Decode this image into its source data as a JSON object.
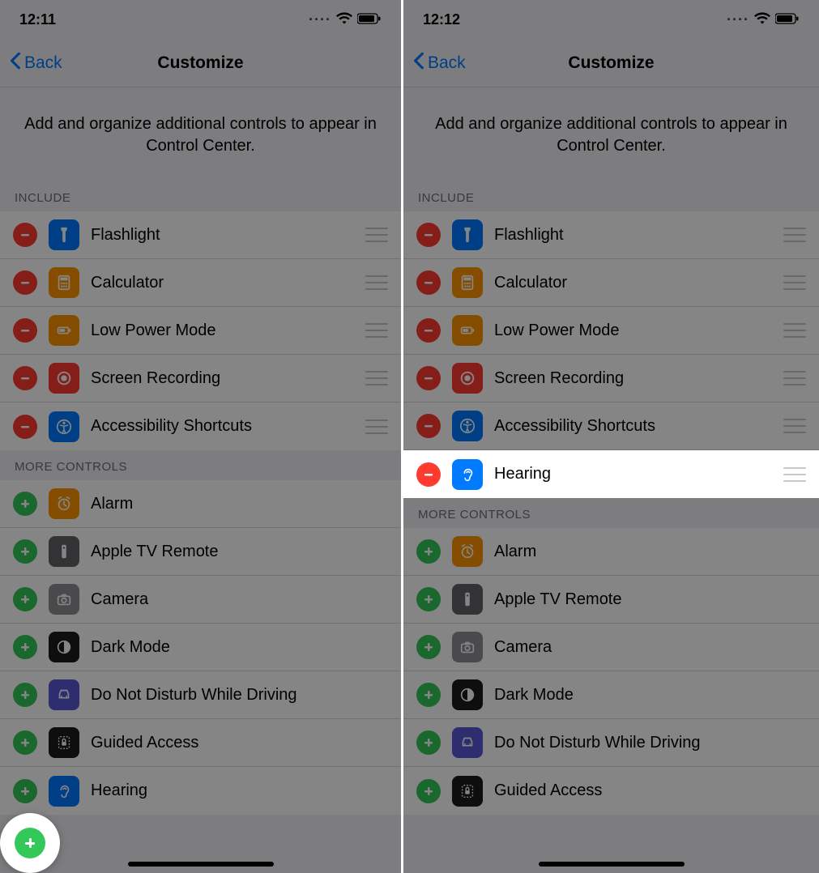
{
  "left": {
    "status": {
      "time": "12:11"
    },
    "nav": {
      "back": "Back",
      "title": "Customize"
    },
    "intro": "Add and organize additional controls to appear in Control Center.",
    "sections": {
      "include_header": "INCLUDE",
      "more_header": "MORE CONTROLS"
    },
    "include": [
      {
        "label": "Flashlight"
      },
      {
        "label": "Calculator"
      },
      {
        "label": "Low Power Mode"
      },
      {
        "label": "Screen Recording"
      },
      {
        "label": "Accessibility Shortcuts"
      }
    ],
    "more": [
      {
        "label": "Alarm"
      },
      {
        "label": "Apple TV Remote"
      },
      {
        "label": "Camera"
      },
      {
        "label": "Dark Mode"
      },
      {
        "label": "Do Not Disturb While Driving"
      },
      {
        "label": "Guided Access"
      },
      {
        "label": "Hearing"
      }
    ]
  },
  "right": {
    "status": {
      "time": "12:12"
    },
    "nav": {
      "back": "Back",
      "title": "Customize"
    },
    "intro": "Add and organize additional controls to appear in Control Center.",
    "sections": {
      "include_header": "INCLUDE",
      "more_header": "MORE CONTROLS"
    },
    "include": [
      {
        "label": "Flashlight"
      },
      {
        "label": "Calculator"
      },
      {
        "label": "Low Power Mode"
      },
      {
        "label": "Screen Recording"
      },
      {
        "label": "Accessibility Shortcuts"
      },
      {
        "label": "Hearing"
      }
    ],
    "more": [
      {
        "label": "Alarm"
      },
      {
        "label": "Apple TV Remote"
      },
      {
        "label": "Camera"
      },
      {
        "label": "Dark Mode"
      },
      {
        "label": "Do Not Disturb While Driving"
      },
      {
        "label": "Guided Access"
      }
    ]
  }
}
